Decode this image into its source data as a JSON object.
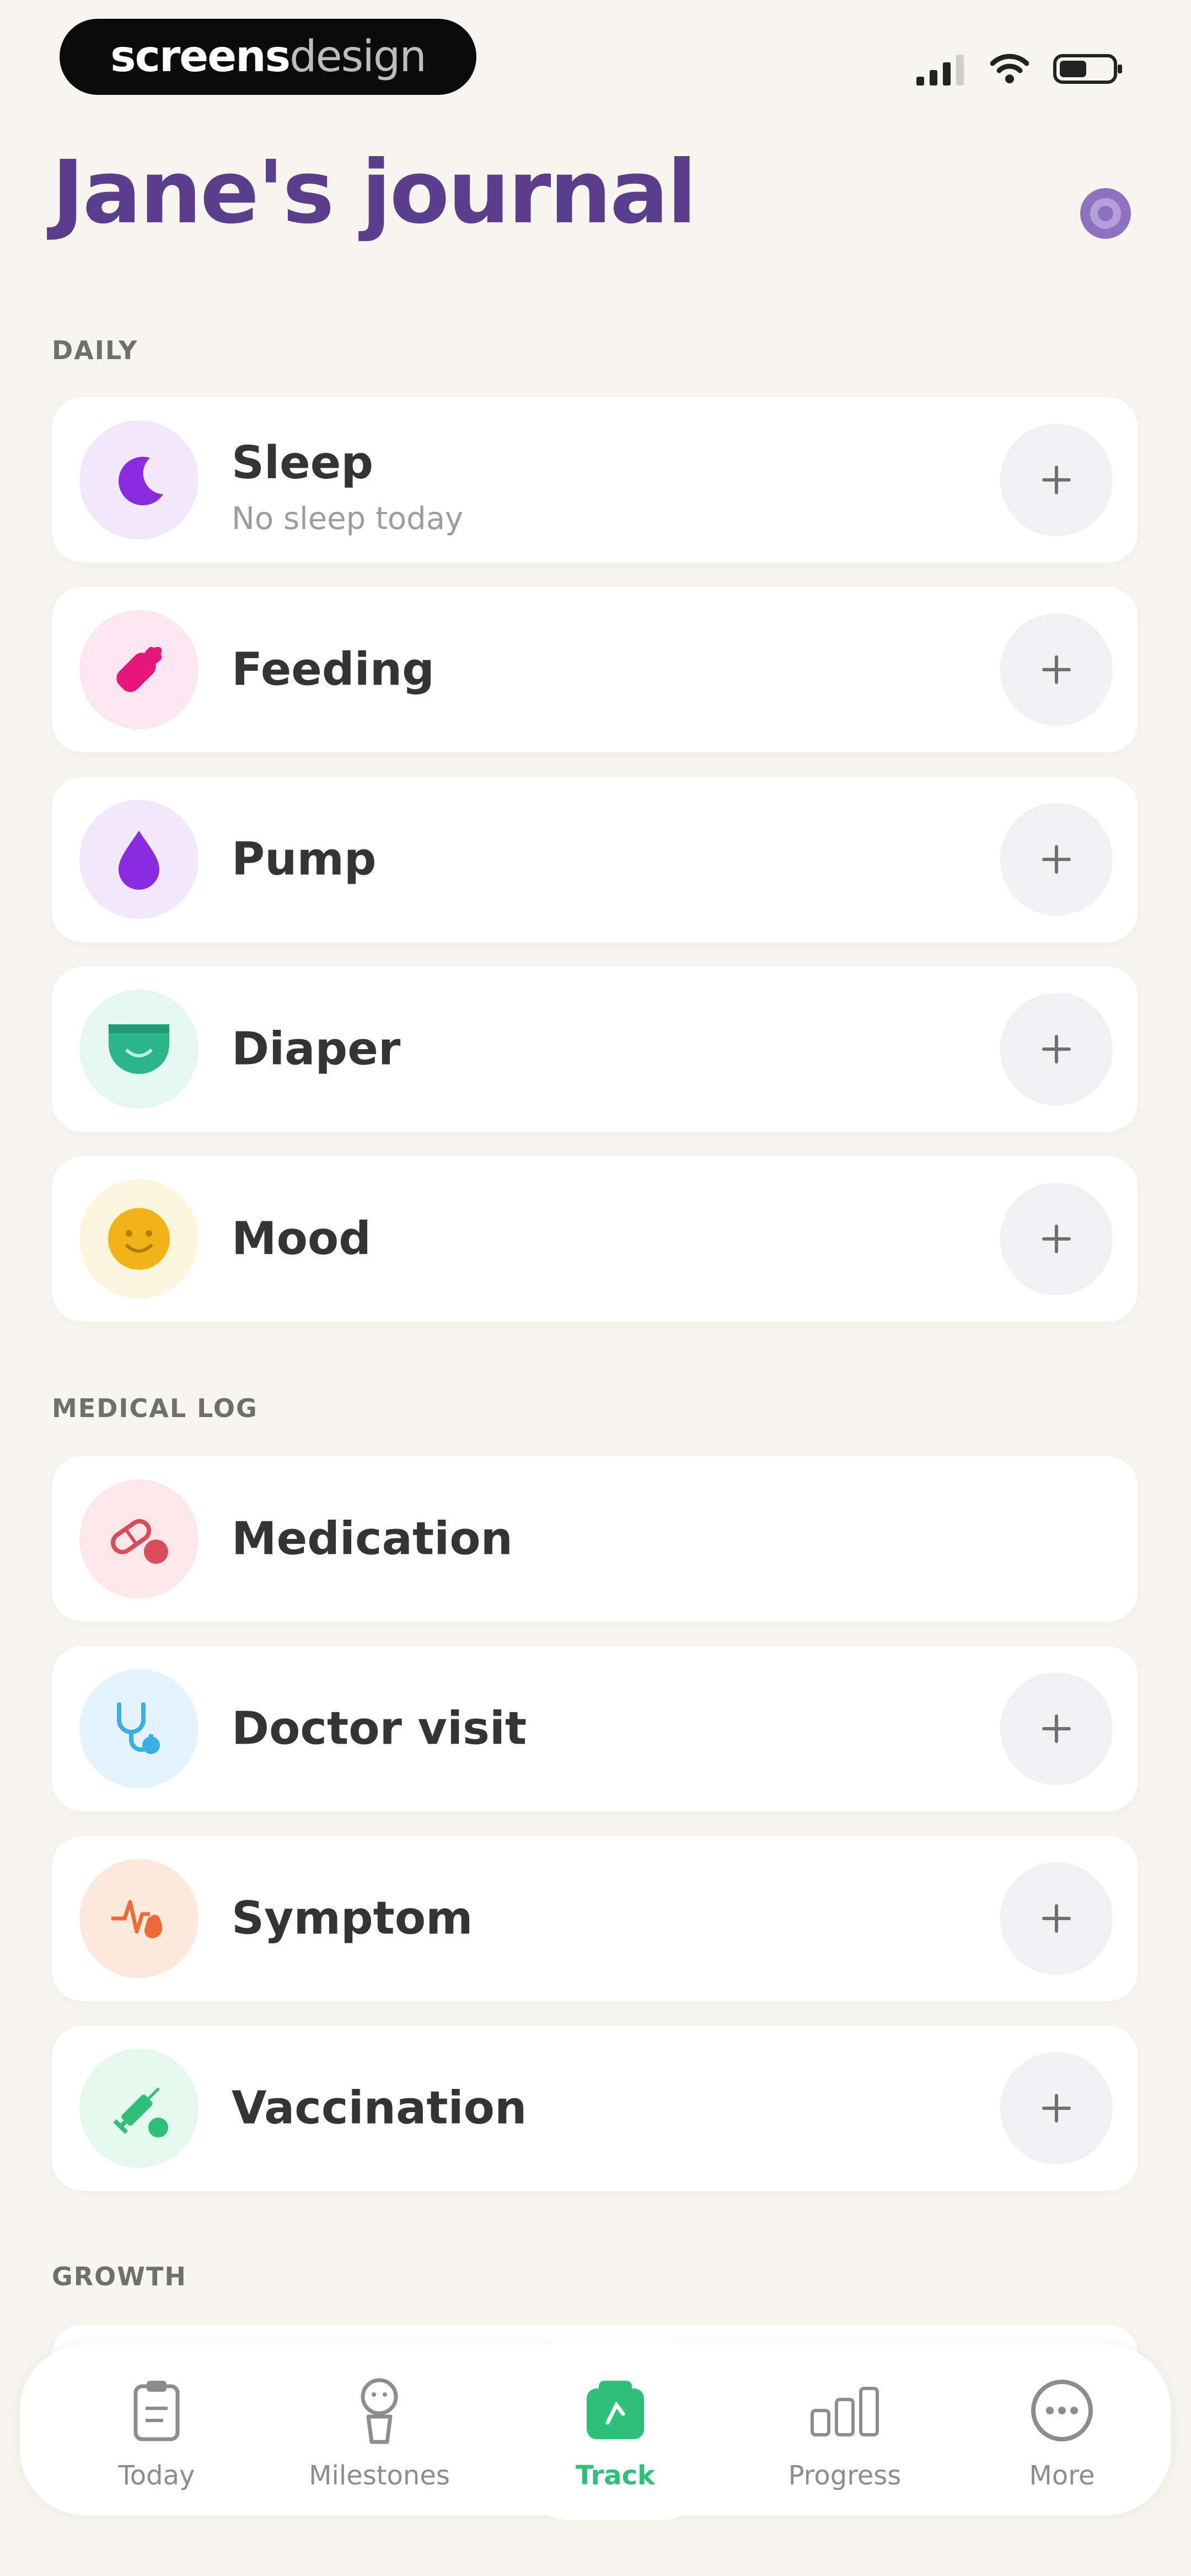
{
  "status_bar": {
    "brand_bold": "screens",
    "brand_light": "design"
  },
  "header": {
    "title": "Jane's journal"
  },
  "sections": {
    "daily": {
      "label": "DAILY",
      "items": [
        {
          "label": "Sleep",
          "subtitle": "No sleep today",
          "icon": "moon-icon",
          "icon_color": "#8a2be2",
          "icon_bg": "#f1e8fb"
        },
        {
          "label": "Feeding",
          "icon": "bottle-icon",
          "icon_color": "#e5157a",
          "icon_bg": "#fce6ef"
        },
        {
          "label": "Pump",
          "icon": "drop-icon",
          "icon_color": "#8a2be2",
          "icon_bg": "#f1e8fb"
        },
        {
          "label": "Diaper",
          "icon": "diaper-icon",
          "icon_color": "#2bb58a",
          "icon_bg": "#e4f7f0"
        },
        {
          "label": "Mood",
          "icon": "smiley-icon",
          "icon_color": "#f0b418",
          "icon_bg": "#fdf5dc"
        }
      ]
    },
    "medical": {
      "label": "MEDICAL LOG",
      "items": [
        {
          "label": "Medication",
          "icon": "pills-icon",
          "icon_color": "#d94c5c",
          "icon_bg": "#fce8eb"
        },
        {
          "label": "Doctor visit",
          "icon": "stethoscope-icon",
          "icon_color": "#3aaee6",
          "icon_bg": "#e4f4fc"
        },
        {
          "label": "Symptom",
          "icon": "symptom-icon",
          "icon_color": "#ef6a3a",
          "icon_bg": "#fde9dc"
        },
        {
          "label": "Vaccination",
          "icon": "syringe-icon",
          "icon_color": "#2fc07a",
          "icon_bg": "#e4f8ee"
        }
      ]
    },
    "growth": {
      "label": "GROWTH"
    }
  },
  "bottom_nav": {
    "items": [
      {
        "label": "Today",
        "icon": "clipboard-icon"
      },
      {
        "label": "Milestones",
        "icon": "milestone-icon"
      },
      {
        "label": "Track",
        "icon": "track-icon",
        "active": true
      },
      {
        "label": "Progress",
        "icon": "bar-chart-icon"
      },
      {
        "label": "More",
        "icon": "more-icon"
      }
    ],
    "active_color": "#2fc07a"
  },
  "colors": {
    "accent": "#5a3f8c",
    "background": "#f7f5f0"
  }
}
